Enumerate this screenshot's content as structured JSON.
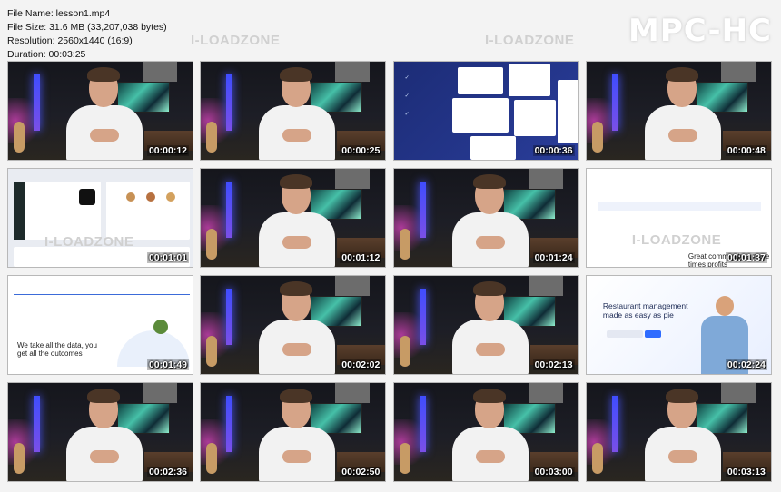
{
  "file_info": {
    "name_line": "File Name: lesson1.mp4",
    "size_line": "File Size: 31.6 MB (33,207,038 bytes)",
    "resolution_line": "Resolution: 2560x1440 (16:9)",
    "duration_line": "Duration: 00:03:25"
  },
  "brand": "MPC-HC",
  "watermark": "I-LOADZONE",
  "thumbnails": [
    {
      "time": "00:00:12",
      "kind": "studio"
    },
    {
      "time": "00:00:25",
      "kind": "studio"
    },
    {
      "time": "00:00:36",
      "kind": "ui-blue"
    },
    {
      "time": "00:00:48",
      "kind": "studio"
    },
    {
      "time": "00:01:01",
      "kind": "ui-dashboard"
    },
    {
      "time": "00:01:12",
      "kind": "studio"
    },
    {
      "time": "00:01:24",
      "kind": "studio"
    },
    {
      "time": "00:01:37",
      "kind": "ui-community"
    },
    {
      "time": "00:01:49",
      "kind": "ui-data"
    },
    {
      "time": "00:02:02",
      "kind": "studio"
    },
    {
      "time": "00:02:13",
      "kind": "studio"
    },
    {
      "time": "00:02:24",
      "kind": "ui-restaurant"
    },
    {
      "time": "00:02:36",
      "kind": "studio"
    },
    {
      "time": "00:02:50",
      "kind": "studio"
    },
    {
      "time": "00:03:00",
      "kind": "studio"
    },
    {
      "time": "00:03:13",
      "kind": "studio"
    }
  ],
  "ui_text": {
    "community": "Great community is more times profits",
    "data": "We take all the data, you get all the outcomes",
    "restaurant": "Restaurant management made as easy as pie"
  }
}
